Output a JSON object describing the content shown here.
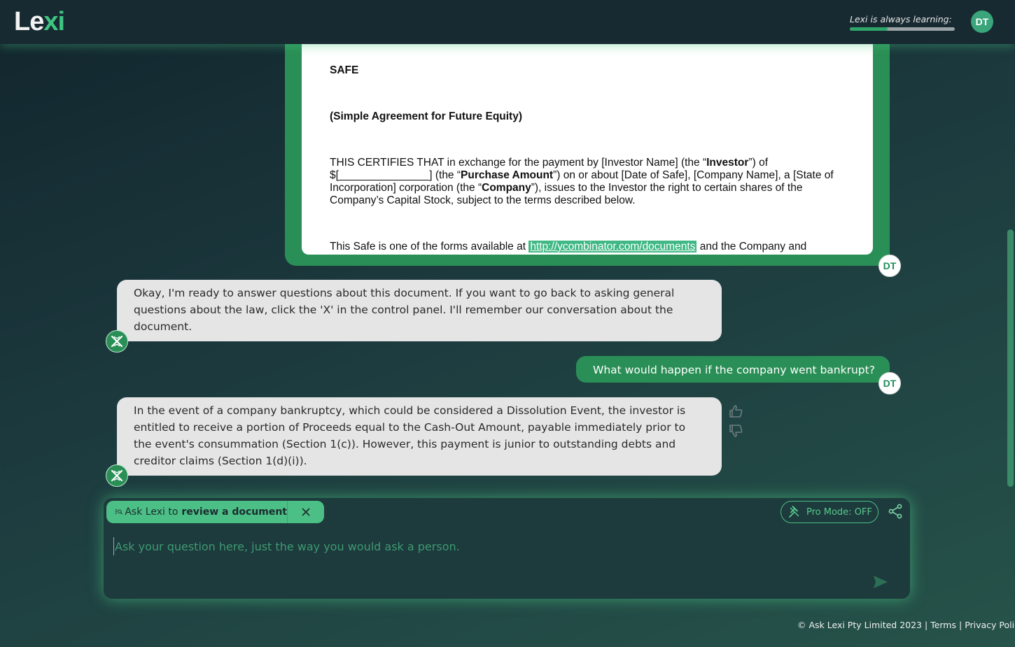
{
  "header": {
    "logo_text": "Le",
    "logo_accent": "xi",
    "learning_label": "Lexi is always learning:",
    "learning_progress": 0.36,
    "user_initials": "DT"
  },
  "document": {
    "title": "SAFE",
    "subtitle": "(Simple Agreement for Future Equity)",
    "p1_a": "THIS CERTIFIES THAT in exchange for the payment by [Investor Name] (the “",
    "p1_b": "Investor",
    "p1_c": "”) of $[_______________] (the “",
    "p1_d": "Purchase Amount",
    "p1_e": "”) on or about [Date of Safe], [Company Name], a [State of Incorporation] corporation (the “",
    "p1_f": "Company",
    "p1_g": "”), issues to the Investor the right to certain shares of the Company’s Capital Stock, subject to the terms described below.",
    "p2_a": "This Safe is one of the forms available at ",
    "p2_link": "http://ycombinator.com/documents",
    "p2_b": " and the Company and"
  },
  "messages": [
    {
      "role": "assistant",
      "text": "Okay, I'm ready to answer questions about this document. If you want to go back to asking general questions about the law, click the 'X' in the control panel. I'll remember our conversation about the document."
    },
    {
      "role": "user",
      "text": "What would happen if the company went bankrupt?",
      "initials": "DT"
    },
    {
      "role": "assistant",
      "text": "In the event of a company bankruptcy, which could be considered a Dissolution Event, the investor is entitled to receive a portion of Proceeds equal to the Cash-Out Amount, payable immediately prior to the event's consummation (Section 1(c)). However, this payment is junior to outstanding debts and creditor claims (Section 1(d)(i))."
    }
  ],
  "doc_sender_initials": "DT",
  "composer": {
    "review_prefix": "Ask Lexi to",
    "review_bold": "review a document",
    "pro_mode_label": "Pro Mode: OFF",
    "placeholder": "Ask your question here, just the way you would ask a person."
  },
  "footer": {
    "copyright": "© Ask Lexi Pty Limited 2023 |",
    "terms": "Terms",
    "sep": "|",
    "privacy": "Privacy Policy"
  },
  "colors": {
    "accent": "#2a8f56",
    "accent_light": "#4cbf86",
    "header_bg": "#172a31"
  },
  "icons": [
    "document-search-icon",
    "close-icon",
    "gavel-icon",
    "share-icon",
    "send-icon",
    "thumbs-up-icon",
    "thumbs-down-icon",
    "lexi-logo-icon"
  ]
}
